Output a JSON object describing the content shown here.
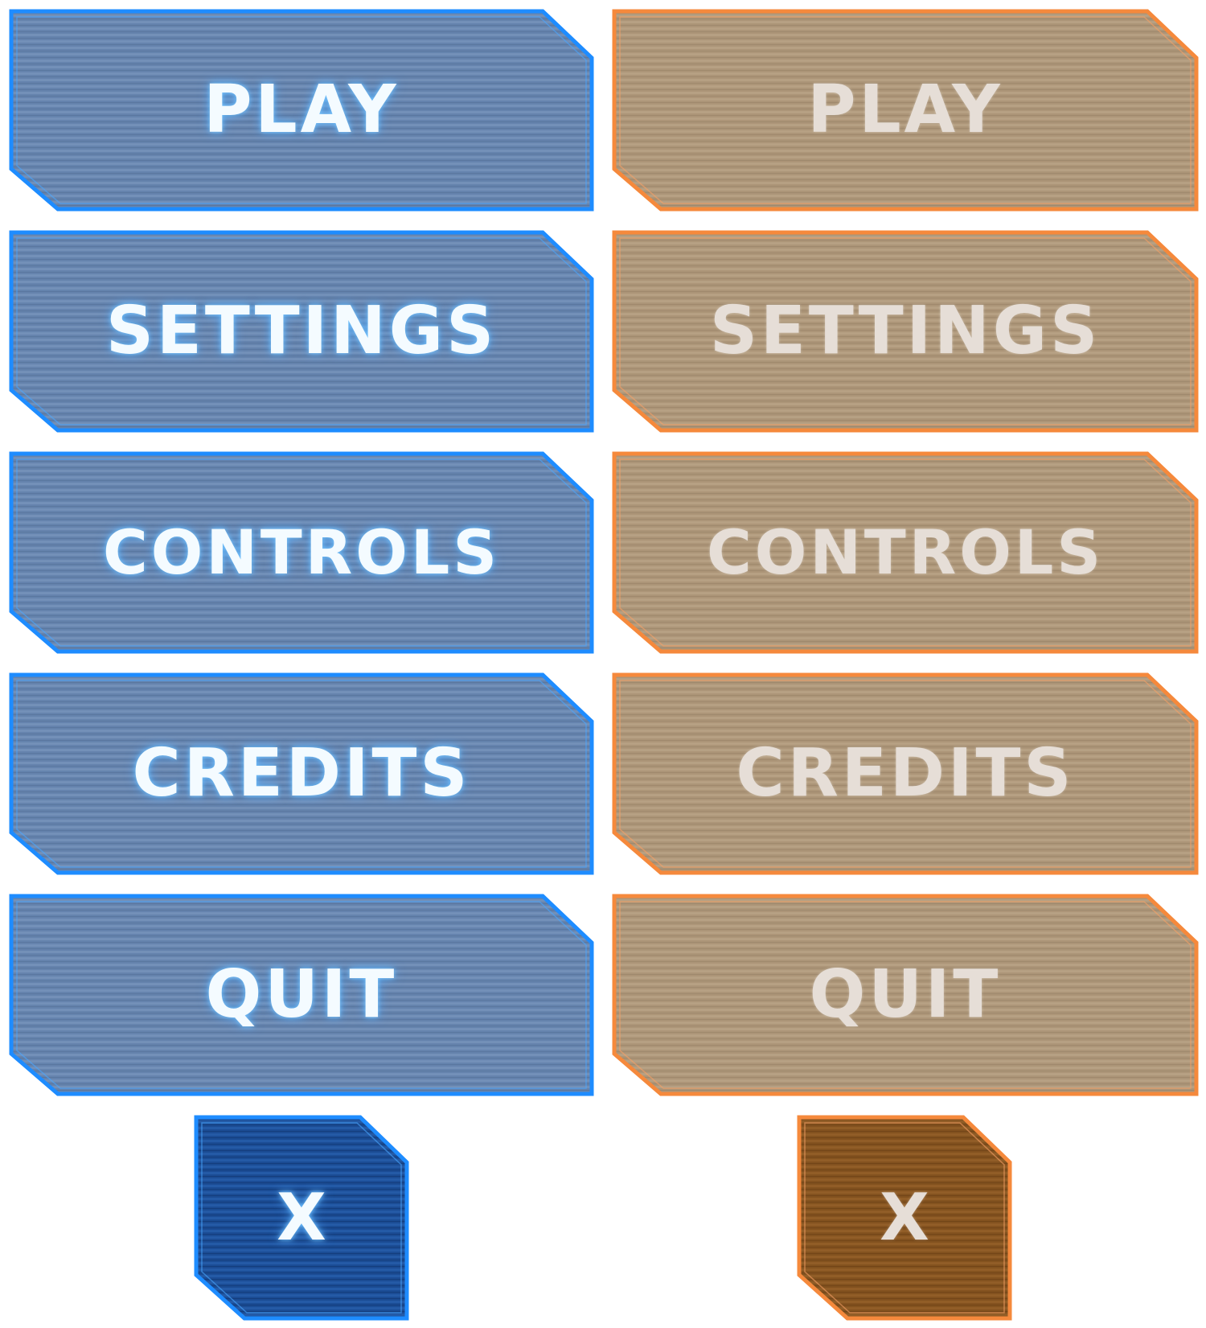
{
  "colors": {
    "blue_border": "#1e8cff",
    "blue_fill": "#6583ad",
    "blue_close_fill": "#1b4c94",
    "orange_border": "#f5893c",
    "orange_fill": "#ac9578",
    "orange_close_fill": "#83521f",
    "blue_text": "#f4fbff",
    "orange_text": "#e6ded7"
  },
  "blue_menu": {
    "play_label": "PLAY",
    "settings_label": "SETTINGS",
    "controls_label": "CONTROLS",
    "credits_label": "CREDITS",
    "quit_label": "QUIT",
    "close_label": "X"
  },
  "orange_menu": {
    "play_label": "PLAY",
    "settings_label": "SETTINGS",
    "controls_label": "CONTROLS",
    "credits_label": "CREDITS",
    "quit_label": "QUIT",
    "close_label": "X"
  }
}
